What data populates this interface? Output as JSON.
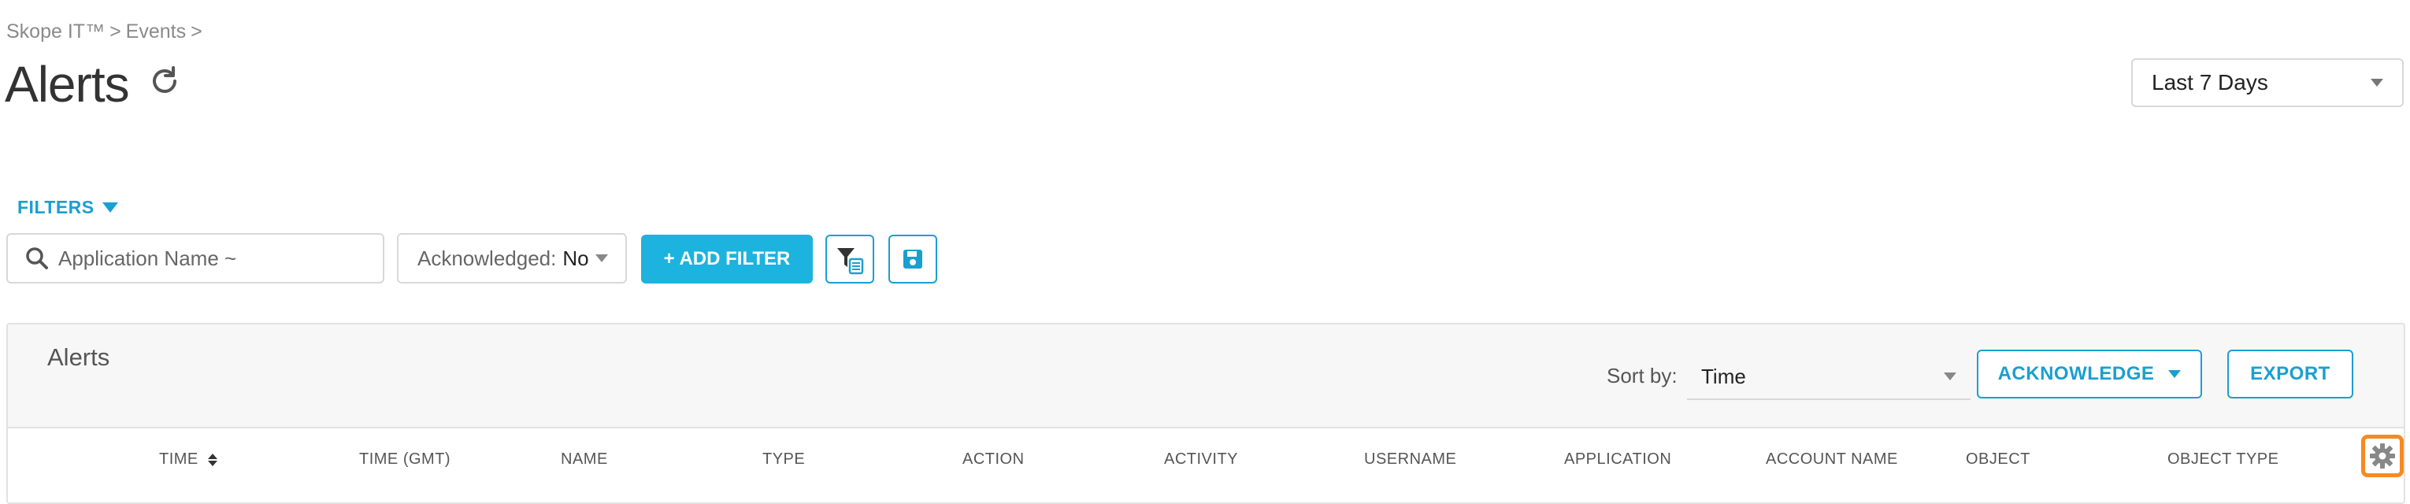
{
  "breadcrumb": [
    "Skope IT™",
    ">",
    "Events",
    ">"
  ],
  "page": {
    "title": "Alerts"
  },
  "date_range": {
    "value": "Last 7 Days"
  },
  "filters": {
    "toggle_label": "FILTERS",
    "search_placeholder": "Application Name ~",
    "acknowledged_label": "Acknowledged:",
    "acknowledged_value": "No",
    "add_filter_label": "+ ADD FILTER"
  },
  "panel": {
    "title": "Alerts",
    "sort_by_label": "Sort by:",
    "sort_by_value": "Time",
    "acknowledge_label": "ACKNOWLEDGE",
    "export_label": "EXPORT",
    "columns": [
      "TIME",
      "TIME (GMT)",
      "NAME",
      "TYPE",
      "ACTION",
      "ACTIVITY",
      "USERNAME",
      "APPLICATION",
      "ACCOUNT NAME",
      "OBJECT",
      "OBJECT TYPE"
    ]
  },
  "colors": {
    "accent": "#1a9fd1",
    "button": "#1cb3de",
    "highlight": "#f58a1f"
  },
  "icons": [
    "refresh-icon",
    "search-icon",
    "filter-list-icon",
    "save-icon",
    "gear-icon",
    "sort-icon"
  ]
}
